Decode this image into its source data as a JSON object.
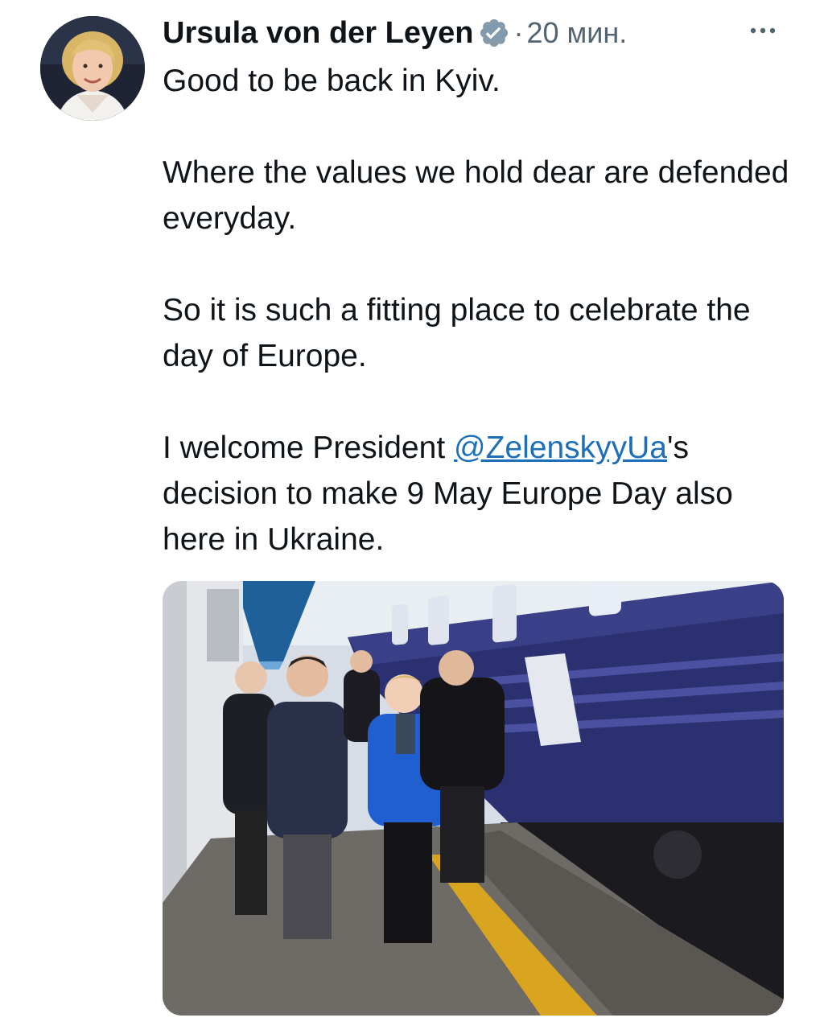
{
  "author": {
    "display_name": "Ursula von der Leyen",
    "verified": true,
    "avatar_icon": "profile-photo"
  },
  "meta": {
    "separator": "·",
    "time": "20 мин."
  },
  "more_icon": "more-horizontal-icon",
  "tweet": {
    "p1": "Good to be back in Kyiv.",
    "p2": "Where the values we hold dear are defended everyday.",
    "p3": "So it is such a fitting place to celebrate the day of Europe.",
    "p4_before": "I welcome President ",
    "p4_mention": "@ZelenskyyUa",
    "p4_after": "'s decision to make 9 May Europe Day also here in Ukraine."
  },
  "colors": {
    "text": "#0f1419",
    "muted": "#536471",
    "link": "#1d6fb8",
    "verified_badge": "#829aab",
    "train": "#2b3070",
    "jacket": "#1f5fd0"
  },
  "media": {
    "type": "photo"
  }
}
